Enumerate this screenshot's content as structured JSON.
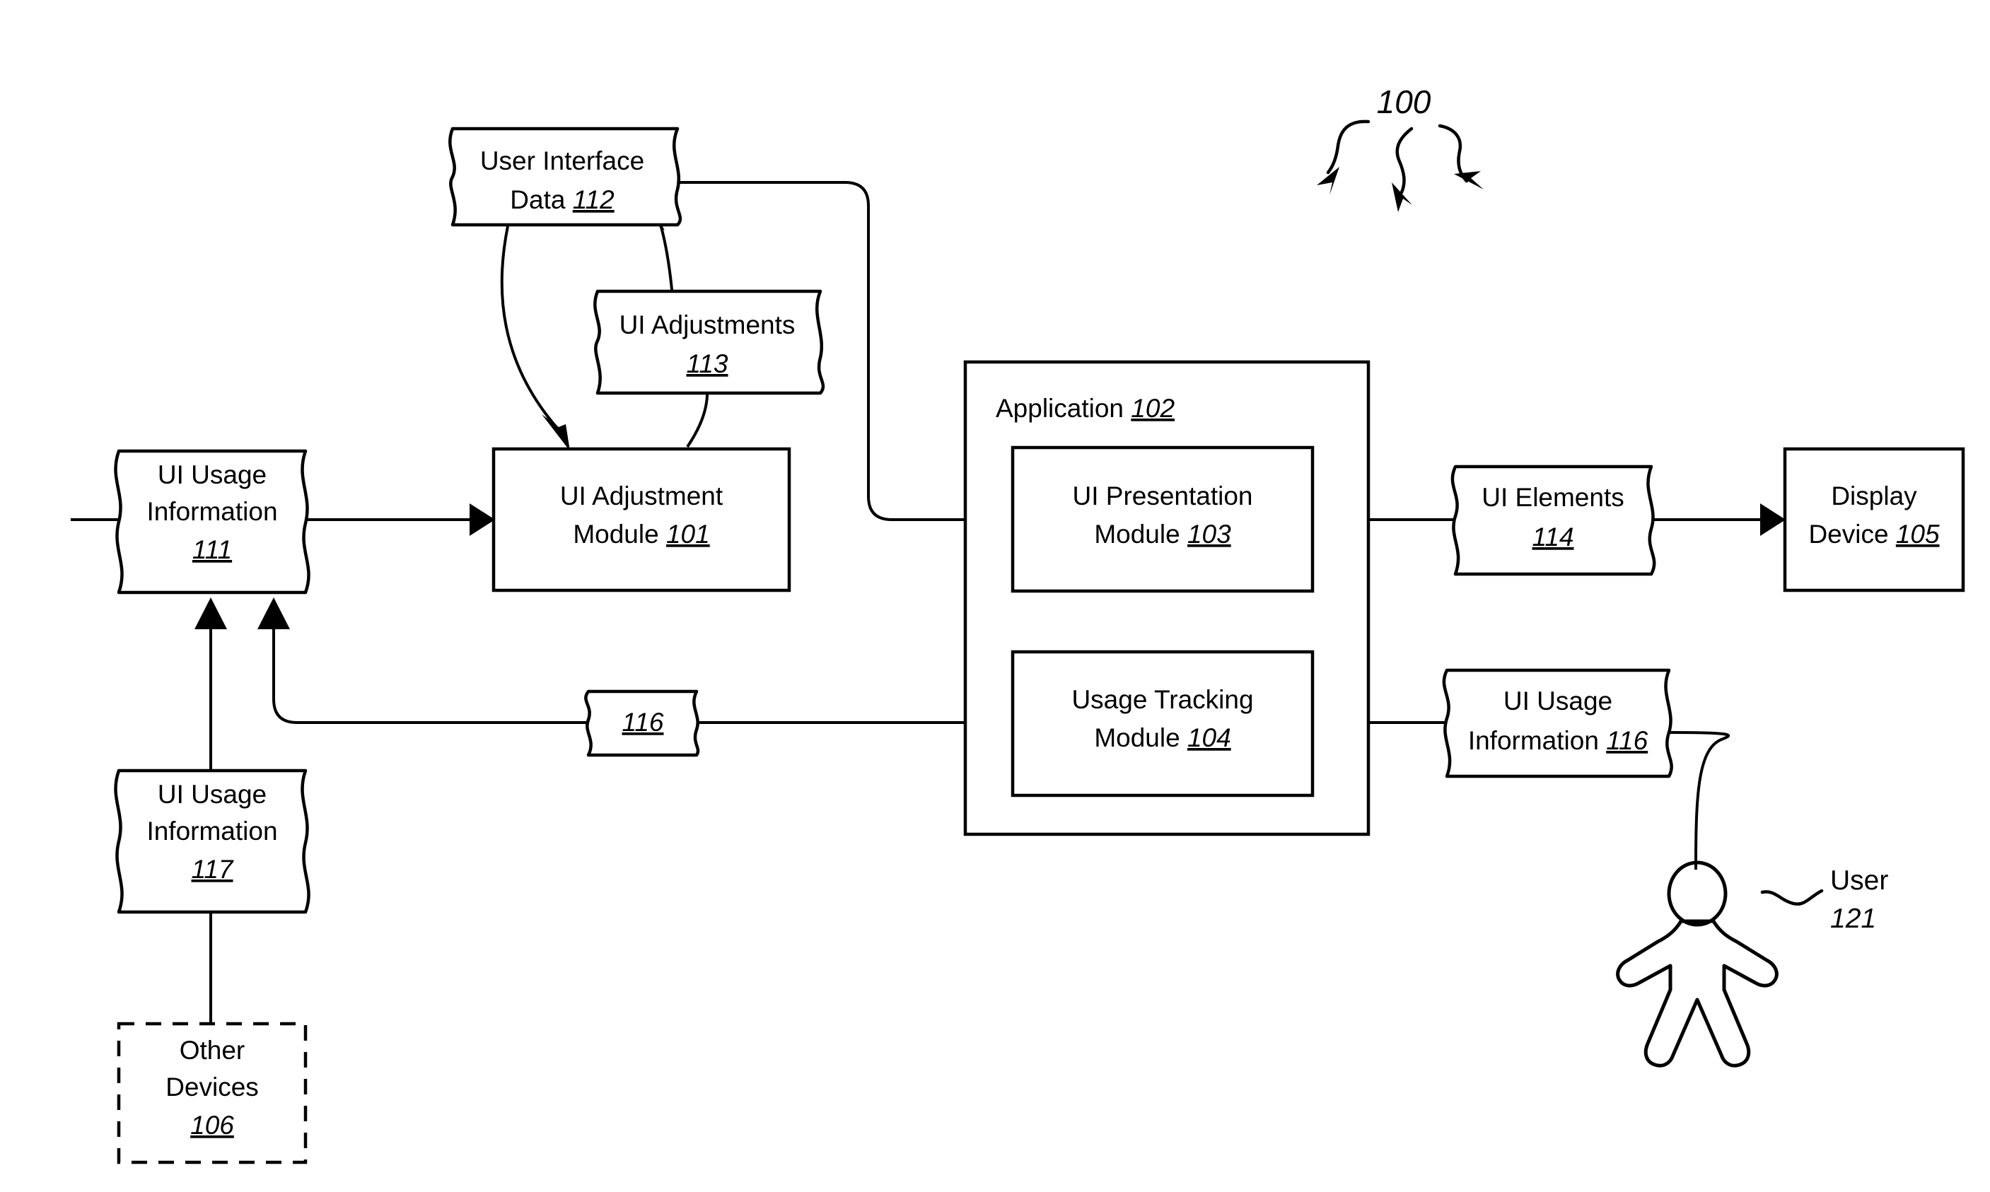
{
  "figure": {
    "number": "100",
    "pointer_icon": "curved-arrow-icon"
  },
  "nodes": {
    "ui_usage_information_111": {
      "shape": "document",
      "lines": [
        "UI Usage",
        "Information"
      ],
      "ref": "111"
    },
    "ui_usage_information_117": {
      "shape": "document",
      "lines": [
        "UI Usage",
        "Information"
      ],
      "ref": "117"
    },
    "other_devices_106": {
      "shape": "dashed-box",
      "lines": [
        "Other",
        "Devices"
      ],
      "ref": "106"
    },
    "user_interface_data_112": {
      "shape": "document",
      "line1": "User Interface",
      "line2_text": "Data ",
      "ref": "112"
    },
    "ui_adjustments_113": {
      "shape": "document",
      "line1": "UI Adjustments",
      "ref": "113"
    },
    "ui_adjustment_module_101": {
      "shape": "box",
      "line1": "UI Adjustment",
      "line2_text": "Module ",
      "ref": "101"
    },
    "application_102": {
      "shape": "box",
      "label_text": "Application  ",
      "ref": "102"
    },
    "ui_presentation_module_103": {
      "shape": "box",
      "line1": "UI Presentation",
      "line2_text": "Module ",
      "ref": "103"
    },
    "usage_tracking_module_104": {
      "shape": "box",
      "line1": "Usage Tracking",
      "line2_text": "Module ",
      "ref": "104"
    },
    "ui_elements_114": {
      "shape": "document",
      "line1": "UI Elements",
      "ref": "114"
    },
    "display_device_105": {
      "shape": "box",
      "line1": "Display",
      "line2_text": "Device ",
      "ref": "105"
    },
    "ui_usage_information_116_right": {
      "shape": "document",
      "line1": "UI Usage",
      "line2_text": "Information ",
      "ref": "116"
    },
    "ui_usage_information_116_mid": {
      "shape": "document",
      "ref": "116"
    },
    "user_121": {
      "shape": "stick-figure",
      "label": "User",
      "ref": "121"
    }
  },
  "colors": {
    "stroke": "#000000",
    "fill": "#ffffff"
  }
}
